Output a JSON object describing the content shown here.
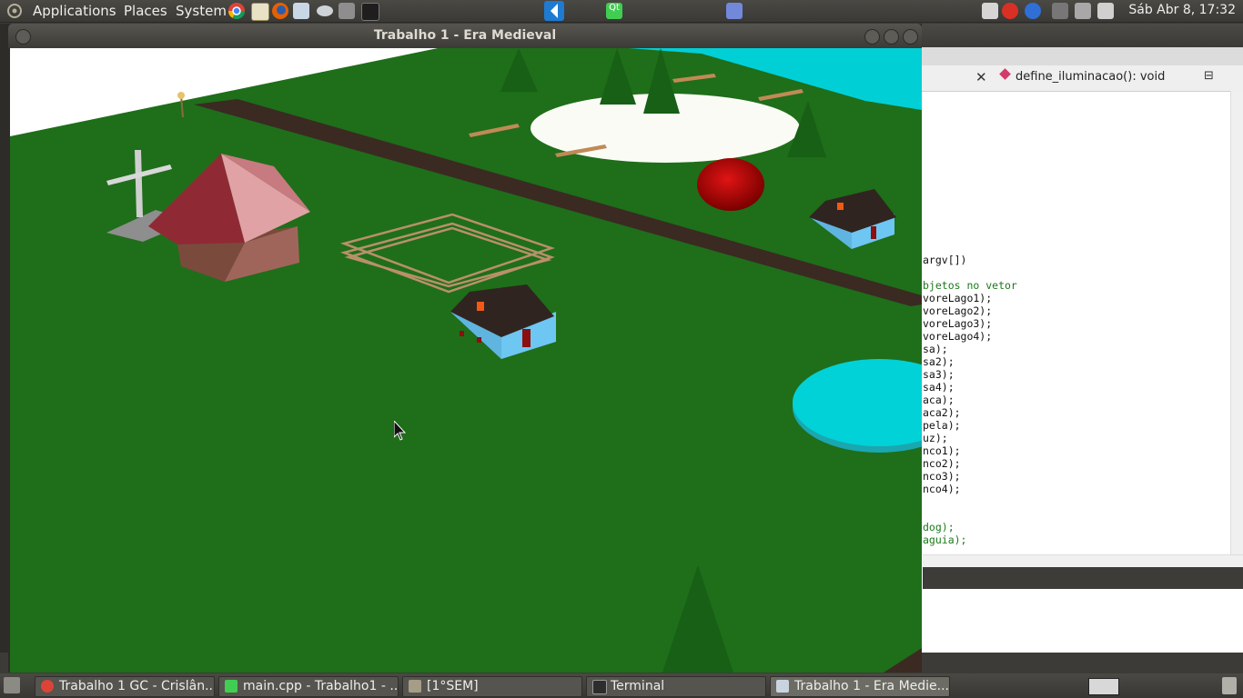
{
  "top_panel": {
    "menus": [
      "Applications",
      "Places",
      "System"
    ],
    "clock": "Sáb Abr 8, 17:32"
  },
  "ide": {
    "function_combo": "define_iluminacao(): void",
    "code_lines": [
      {
        "text": "argv[])",
        "comment": false
      },
      {
        "text": "",
        "comment": false
      },
      {
        "text": "bjetos no vetor",
        "comment": true
      },
      {
        "text": "voreLago1);",
        "comment": false
      },
      {
        "text": "voreLago2);",
        "comment": false
      },
      {
        "text": "voreLago3);",
        "comment": false
      },
      {
        "text": "voreLago4);",
        "comment": false
      },
      {
        "text": "sa);",
        "comment": false
      },
      {
        "text": "sa2);",
        "comment": false
      },
      {
        "text": "sa3);",
        "comment": false
      },
      {
        "text": "sa4);",
        "comment": false
      },
      {
        "text": "aca);",
        "comment": false
      },
      {
        "text": "aca2);",
        "comment": false
      },
      {
        "text": "pela);",
        "comment": false
      },
      {
        "text": "uz);",
        "comment": false
      },
      {
        "text": "nco1);",
        "comment": false
      },
      {
        "text": "nco2);",
        "comment": false
      },
      {
        "text": "nco3);",
        "comment": false
      },
      {
        "text": "nco4);",
        "comment": false
      },
      {
        "text": "",
        "comment": false
      },
      {
        "text": "",
        "comment": false
      },
      {
        "text": "dog);",
        "comment": true
      },
      {
        "text": "aguia);",
        "comment": true
      }
    ]
  },
  "gl_window": {
    "title": "Trabalho 1 - Era Medieval"
  },
  "taskbar": {
    "tasks": [
      {
        "label": "Trabalho 1 GC - Crislân...",
        "icon": "chrome-icon"
      },
      {
        "label": "main.cpp - Trabalho1 - ...",
        "icon": "qtcreator-icon"
      },
      {
        "label": "[1°SEM]",
        "icon": "folder-icon"
      },
      {
        "label": "Terminal",
        "icon": "terminal-icon"
      },
      {
        "label": "Trabalho 1 - Era Medie...",
        "icon": "window-icon"
      }
    ]
  },
  "colors": {
    "grass": "#1f6e1a",
    "road": "#3a2a22",
    "lake": "#00d2d8",
    "sky": "#ffffff"
  }
}
